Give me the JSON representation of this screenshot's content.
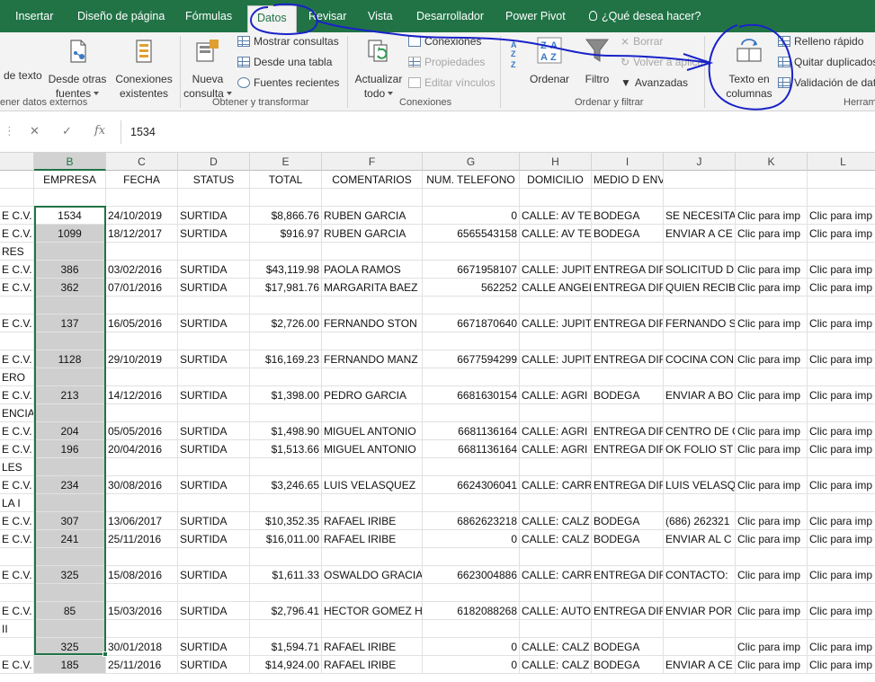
{
  "tabs": [
    {
      "label": "Insertar",
      "active": false
    },
    {
      "label": "Diseño de página",
      "active": false
    },
    {
      "label": "Fórmulas",
      "active": false
    },
    {
      "label": "Datos",
      "active": true
    },
    {
      "label": "Revisar",
      "active": false
    },
    {
      "label": "Vista",
      "active": false
    },
    {
      "label": "Desarrollador",
      "active": false
    },
    {
      "label": "Power Pivot",
      "active": false
    },
    {
      "label": "¿Qué desea hacer?",
      "active": false
    }
  ],
  "ribbon": {
    "get_external": {
      "text_label": "de texto",
      "other_sources_line1": "Desde otras",
      "other_sources_line2": "fuentes",
      "existing_line1": "Conexiones",
      "existing_line2": "existentes",
      "group_label": "ener datos externos"
    },
    "get_transform": {
      "new_query_line1": "Nueva",
      "new_query_line2": "consulta",
      "show_queries": "Mostrar consultas",
      "from_table": "Desde una tabla",
      "recent_sources": "Fuentes recientes",
      "group_label": "Obtener y transformar"
    },
    "connections": {
      "refresh_line1": "Actualizar",
      "refresh_line2": "todo",
      "connections": "Conexiones",
      "properties": "Propiedades",
      "edit_links": "Editar vínculos",
      "group_label": "Conexiones"
    },
    "sort_filter": {
      "sort": "Ordenar",
      "filter": "Filtro",
      "clear": "Borrar",
      "reapply": "Volver a aplicar",
      "advanced": "Avanzadas",
      "group_label": "Ordenar y filtrar"
    },
    "tools": {
      "text_to_columns_line1": "Texto en",
      "text_to_columns_line2": "columnas",
      "flash_fill": "Relleno rápido",
      "remove_duplicates": "Quitar duplicados",
      "data_validation": "Validación de datos",
      "group_label": "Herram"
    }
  },
  "formula_bar": {
    "value": "1534"
  },
  "sheet": {
    "columns": [
      "B",
      "C",
      "D",
      "E",
      "F",
      "G",
      "H",
      "I",
      "J",
      "K",
      "L"
    ],
    "selected_column": "B",
    "header_row": [
      "",
      "EMPRESA",
      "FECHA",
      "STATUS",
      "TOTAL",
      "COMENTARIOS",
      "NUM. TELEFONO",
      "DOMICILIO",
      "MEDIO D ENVIO",
      "",
      "",
      ""
    ],
    "rows": [
      [
        "",
        "",
        "",
        "",
        "",
        "",
        "",
        "",
        "",
        "",
        "",
        ""
      ],
      [
        "E C.V.",
        "1534",
        "24/10/2019",
        "SURTIDA",
        "$8,866.76",
        "RUBEN GARCIA",
        "0",
        "CALLE: AV TE",
        "BODEGA",
        "SE NECESITA",
        "Clic para imp",
        "Clic para imp"
      ],
      [
        "E C.V.",
        "1099",
        "18/12/2017",
        "SURTIDA",
        "$916.97",
        "RUBEN GARCIA",
        "6565543158",
        "CALLE: AV TE",
        "BODEGA",
        "ENVIAR A CE",
        "Clic para imp",
        "Clic para imp"
      ],
      [
        "RES",
        "",
        "",
        "",
        "",
        "",
        "",
        "",
        "",
        "",
        "",
        ""
      ],
      [
        "E C.V.",
        "386",
        "03/02/2016",
        "SURTIDA",
        "$43,119.98",
        "PAOLA RAMOS",
        "6671958107",
        "CALLE: JUPIT",
        "ENTREGA DIF",
        "SOLICITUD D",
        "Clic para imp",
        "Clic para imp"
      ],
      [
        "E C.V.",
        "362",
        "07/01/2016",
        "SURTIDA",
        "$17,981.76",
        "MARGARITA BAEZ",
        "562252",
        "CALLE ANGEL",
        "ENTREGA DIF",
        "QUIEN RECIB",
        "Clic para imp",
        "Clic para imp"
      ],
      [
        "",
        "",
        "",
        "",
        "",
        "",
        "",
        "",
        "",
        "",
        "",
        ""
      ],
      [
        "E C.V.",
        "137",
        "16/05/2016",
        "SURTIDA",
        "$2,726.00",
        "FERNANDO STON",
        "6671870640",
        "CALLE: JUPIT",
        "ENTREGA DIF",
        "FERNANDO S",
        "Clic para imp",
        "Clic para imp"
      ],
      [
        "",
        "",
        "",
        "",
        "",
        "",
        "",
        "",
        "",
        "",
        "",
        ""
      ],
      [
        "E C.V.",
        "1128",
        "29/10/2019",
        "SURTIDA",
        "$16,169.23",
        "FERNANDO MANZ",
        "6677594299",
        "CALLE: JUPIT",
        "ENTREGA DIF",
        "COCINA CON",
        "Clic para imp",
        "Clic para imp"
      ],
      [
        "ERO",
        "",
        "",
        "",
        "",
        "",
        "",
        "",
        "",
        "",
        "",
        ""
      ],
      [
        "E C.V.",
        "213",
        "14/12/2016",
        "SURTIDA",
        "$1,398.00",
        "PEDRO GARCIA",
        "6681630154",
        "CALLE: AGRI",
        "BODEGA",
        "ENVIAR A BO",
        "Clic para imp",
        "Clic para imp"
      ],
      [
        "ENCIA",
        "",
        "",
        "",
        "",
        "",
        "",
        "",
        "",
        "",
        "",
        ""
      ],
      [
        "E C.V.",
        "204",
        "05/05/2016",
        "SURTIDA",
        "$1,498.90",
        "MIGUEL ANTONIO",
        "6681136164",
        "CALLE: AGRI",
        "ENTREGA DIF",
        "CENTRO DE C",
        "Clic para imp",
        "Clic para imp"
      ],
      [
        "E C.V.",
        "196",
        "20/04/2016",
        "SURTIDA",
        "$1,513.66",
        "MIGUEL ANTONIO",
        "6681136164",
        "CALLE: AGRI",
        "ENTREGA DIF",
        "OK FOLIO ST",
        "Clic para imp",
        "Clic para imp"
      ],
      [
        "LES",
        "",
        "",
        "",
        "",
        "",
        "",
        "",
        "",
        "",
        "",
        ""
      ],
      [
        "E C.V.",
        "234",
        "30/08/2016",
        "SURTIDA",
        "$3,246.65",
        "LUIS VELASQUEZ",
        "6624306041",
        "CALLE: CARR",
        "ENTREGA DIF",
        "LUIS VELASQ",
        "Clic para imp",
        "Clic para imp"
      ],
      [
        "LA I",
        "",
        "",
        "",
        "",
        "",
        "",
        "",
        "",
        "",
        "",
        ""
      ],
      [
        "E C.V.",
        "307",
        "13/06/2017",
        "SURTIDA",
        "$10,352.35",
        "RAFAEL IRIBE",
        "6862623218",
        "CALLE: CALZ",
        "BODEGA",
        "(686) 262321",
        "Clic para imp",
        "Clic para imp"
      ],
      [
        "E C.V.",
        "241",
        "25/11/2016",
        "SURTIDA",
        "$16,011.00",
        "RAFAEL IRIBE",
        "0",
        "CALLE: CALZ",
        "BODEGA",
        "ENVIAR AL C",
        "Clic para imp",
        "Clic para imp"
      ],
      [
        "",
        "",
        "",
        "",
        "",
        "",
        "",
        "",
        "",
        "",
        "",
        ""
      ],
      [
        "E C.V.",
        "325",
        "15/08/2016",
        "SURTIDA",
        "$1,611.33",
        "OSWALDO GRACIA",
        "6623004886",
        "CALLE: CARR",
        "ENTREGA DIF",
        "CONTACTO:",
        "Clic para imp",
        "Clic para imp"
      ],
      [
        "",
        "",
        "",
        "",
        "",
        "",
        "",
        "",
        "",
        "",
        "",
        ""
      ],
      [
        "E C.V.",
        "85",
        "15/03/2016",
        "SURTIDA",
        "$2,796.41",
        "HECTOR GOMEZ H",
        "6182088268",
        "CALLE: AUTO",
        "ENTREGA DIF",
        "ENVIAR POR",
        "Clic para imp",
        "Clic para imp"
      ],
      [
        "II",
        "",
        "",
        "",
        "",
        "",
        "",
        "",
        "",
        "",
        "",
        ""
      ],
      [
        "",
        "325",
        "30/01/2018",
        "SURTIDA",
        "$1,594.71",
        "RAFAEL IRIBE",
        "0",
        "CALLE: CALZ",
        "BODEGA",
        "",
        "Clic para imp",
        "Clic para imp"
      ],
      [
        "E C.V.",
        "185",
        "25/11/2016",
        "SURTIDA",
        "$14,924.00",
        "RAFAEL IRIBE",
        "0",
        "CALLE: CALZ",
        "BODEGA",
        "ENVIAR A CE",
        "Clic para imp",
        "Clic para imp"
      ]
    ]
  },
  "colors": {
    "brand_green": "#217346",
    "annotation_blue": "#1a22c8",
    "selection_gray": "#cfcfcf"
  }
}
